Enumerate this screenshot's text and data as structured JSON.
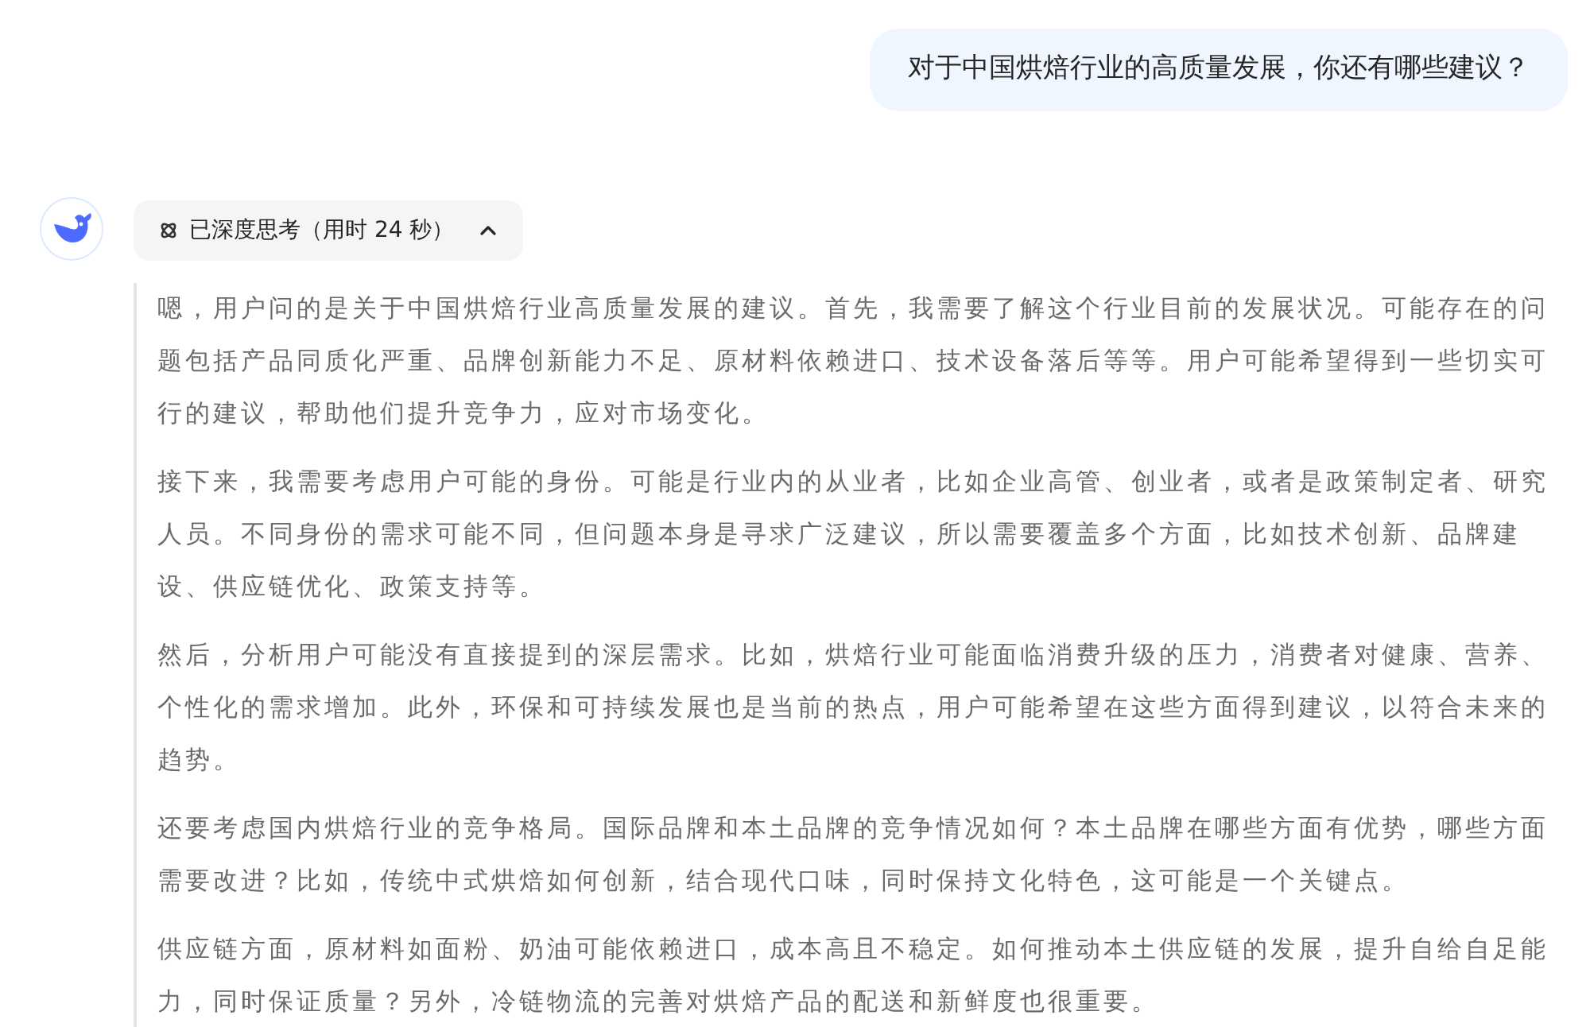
{
  "user_message": {
    "text": "对于中国烘焙行业的高质量发展，你还有哪些建议？"
  },
  "assistant": {
    "thinking_toggle": {
      "label": "已深度思考（用时 24 秒）",
      "expanded": true
    },
    "thinking_paragraphs": [
      "嗯，用户问的是关于中国烘焙行业高质量发展的建议。首先，我需要了解这个行业目前的发展状况。可能存在的问题包括产品同质化严重、品牌创新能力不足、原材料依赖进口、技术设备落后等等。用户可能希望得到一些切实可行的建议，帮助他们提升竞争力，应对市场变化。",
      "接下来，我需要考虑用户可能的身份。可能是行业内的从业者，比如企业高管、创业者，或者是政策制定者、研究人员。不同身份的需求可能不同，但问题本身是寻求广泛建议，所以需要覆盖多个方面，比如技术创新、品牌建设、供应链优化、政策支持等。",
      "然后，分析用户可能没有直接提到的深层需求。比如，烘焙行业可能面临消费升级的压力，消费者对健康、营养、个性化的需求增加。此外，环保和可持续发展也是当前的热点，用户可能希望在这些方面得到建议，以符合未来的趋势。",
      "还要考虑国内烘焙行业的竞争格局。国际品牌和本土品牌的竞争情况如何？本土品牌在哪些方面有优势，哪些方面需要改进？比如，传统中式烘焙如何创新，结合现代口味，同时保持文化特色，这可能是一个关键点。",
      "供应链方面，原材料如面粉、奶油可能依赖进口，成本高且不稳定。如何推动本土供应链的发展，提升自给自足能力，同时保证质量？另外，冷链物流的完善对烘焙产品的配送和新鲜度也很重要。"
    ]
  }
}
